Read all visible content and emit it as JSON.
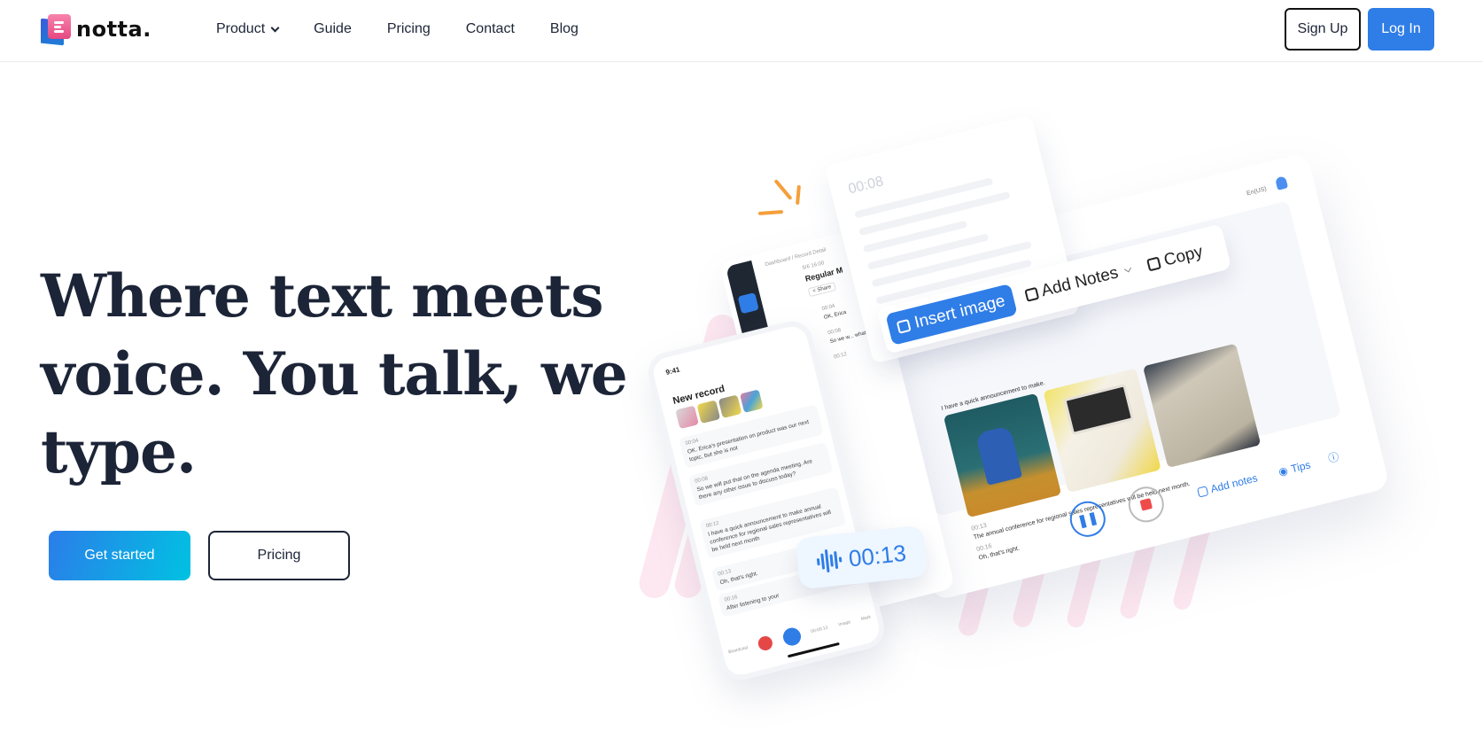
{
  "nav": {
    "brand": "notta.",
    "links": [
      {
        "label": "Product",
        "has_dropdown": true
      },
      {
        "label": "Guide"
      },
      {
        "label": "Pricing"
      },
      {
        "label": "Contact"
      },
      {
        "label": "Blog"
      }
    ],
    "signup_label": "Sign Up",
    "login_label": "Log In"
  },
  "hero": {
    "headline": "Where text meets voice. You talk, we type.",
    "primary_cta": "Get started",
    "secondary_cta": "Pricing"
  },
  "illustration": {
    "note_card": {
      "timestamp": "00:08"
    },
    "toolbar": {
      "insert_image": "Insert image",
      "add_notes": "Add Notes",
      "copy": "Copy"
    },
    "desktop": {
      "language": "En(US)",
      "breadcrumb": "Dashboard / Record Detail",
      "date": "5/6 16:00",
      "record_title": "Regular M",
      "share": "< Share",
      "transcript": [
        {
          "time": "00:04",
          "text": "OK, Erica"
        },
        {
          "time": "00:08",
          "text": "So we w... what we"
        },
        {
          "time": "00:12",
          "text": "I have a quick announcement to make."
        },
        {
          "time": "00:13",
          "text": "The annual conference for regional sales representatives will be held next month."
        },
        {
          "time": "00:16",
          "text": "Oh, that's right."
        }
      ],
      "bottom_links": {
        "add_notes": "Add notes",
        "tips": "Tips"
      }
    },
    "phone": {
      "time": "9:41",
      "title": "New record",
      "segments": [
        {
          "time": "00:04",
          "text": "OK. Erica's presentation on product was our next topic, but she is not"
        },
        {
          "time": "00:08",
          "text": "So we will put that on the agenda meeting. Are there any other issue to discuss today?"
        },
        {
          "time": "00:12",
          "text": "I have a quick announcement to make annual conference for regional sales representatives will be held next month"
        },
        {
          "time": "00:13",
          "text": "Oh, that's right."
        },
        {
          "time": "00:16",
          "text": "After listening to your"
        }
      ],
      "controls": [
        "Boardcast",
        "Stop",
        "00:00:13",
        "Image",
        "Mark"
      ]
    },
    "timer": "00:13"
  },
  "colors": {
    "primary": "#2f7de7",
    "text_dark": "#1c2437",
    "cta_gradient_end": "#00c2e2",
    "accent_orange": "#f59f3b",
    "stop_red": "#ef4b4b"
  }
}
